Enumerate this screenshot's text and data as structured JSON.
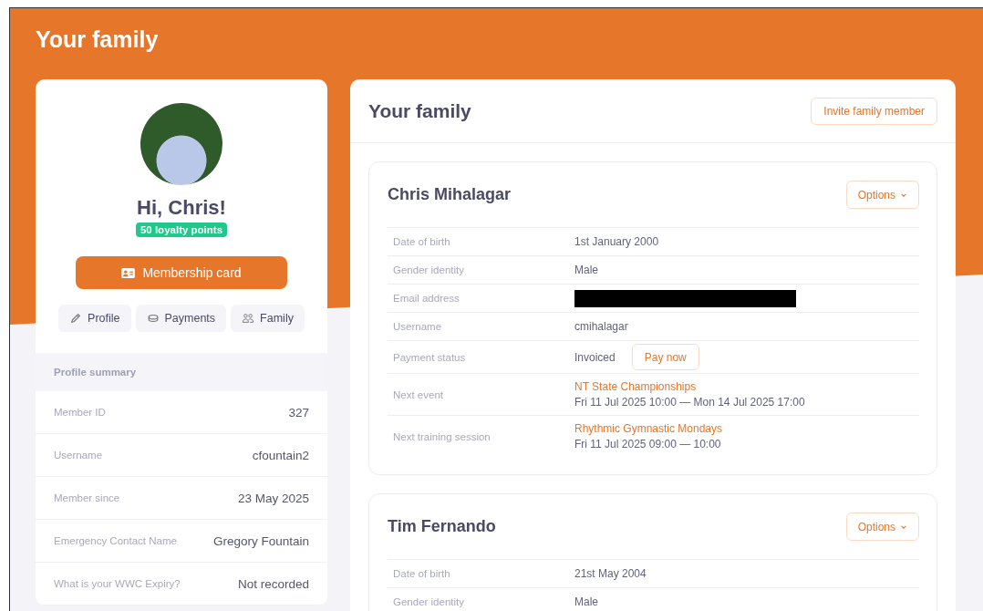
{
  "page": {
    "title": "Your family"
  },
  "profile": {
    "greeting": "Hi, Chris!",
    "badge": "50 loyalty points",
    "card_button": "Membership card",
    "tabs": [
      {
        "label": "Profile",
        "kind": "pencil",
        "selected": false
      },
      {
        "label": "Payments",
        "kind": "coins",
        "selected": false
      },
      {
        "label": "Family",
        "kind": "people",
        "selected": false
      }
    ],
    "summary_title": "Profile summary",
    "summary": [
      {
        "label": "Member ID",
        "value": "327"
      },
      {
        "label": "Username",
        "value": "cfountain2"
      },
      {
        "label": "Member since",
        "value": "23 May 2025"
      },
      {
        "label": "Emergency Contact Name",
        "value": "Gregory Fountain"
      },
      {
        "label": "What is your WWC Expiry?",
        "value": "Not recorded"
      }
    ]
  },
  "family": {
    "title": "Your family",
    "invite_button": "Invite family member",
    "members": [
      {
        "name": "Chris Mihalagar",
        "options_button": "Options",
        "rows": [
          {
            "kind": "text",
            "label": "Date of birth",
            "value": "1st January 2000"
          },
          {
            "kind": "text",
            "label": "Gender identity",
            "value": "Male"
          },
          {
            "kind": "redacted",
            "label": "Email address"
          },
          {
            "kind": "text",
            "label": "Username",
            "value": "cmihalagar"
          },
          {
            "kind": "payment",
            "label": "Payment status",
            "value": "Invoiced",
            "button": "Pay now"
          },
          {
            "kind": "event",
            "label": "Next event",
            "link": "NT State Championships",
            "value": "Fri 11 Jul 2025 10:00 — Mon 14 Jul 2025 17:00"
          },
          {
            "kind": "event",
            "label": "Next training session",
            "link": "Rhythmic Gymnastic Mondays",
            "value": "Fri 11 Jul 2025 09:00 — 10:00"
          }
        ]
      },
      {
        "name": "Tim Fernando",
        "options_button": "Options",
        "rows": [
          {
            "kind": "text",
            "label": "Date of birth",
            "value": "21st May 2004"
          },
          {
            "kind": "text",
            "label": "Gender identity",
            "value": "Male"
          }
        ]
      }
    ]
  }
}
